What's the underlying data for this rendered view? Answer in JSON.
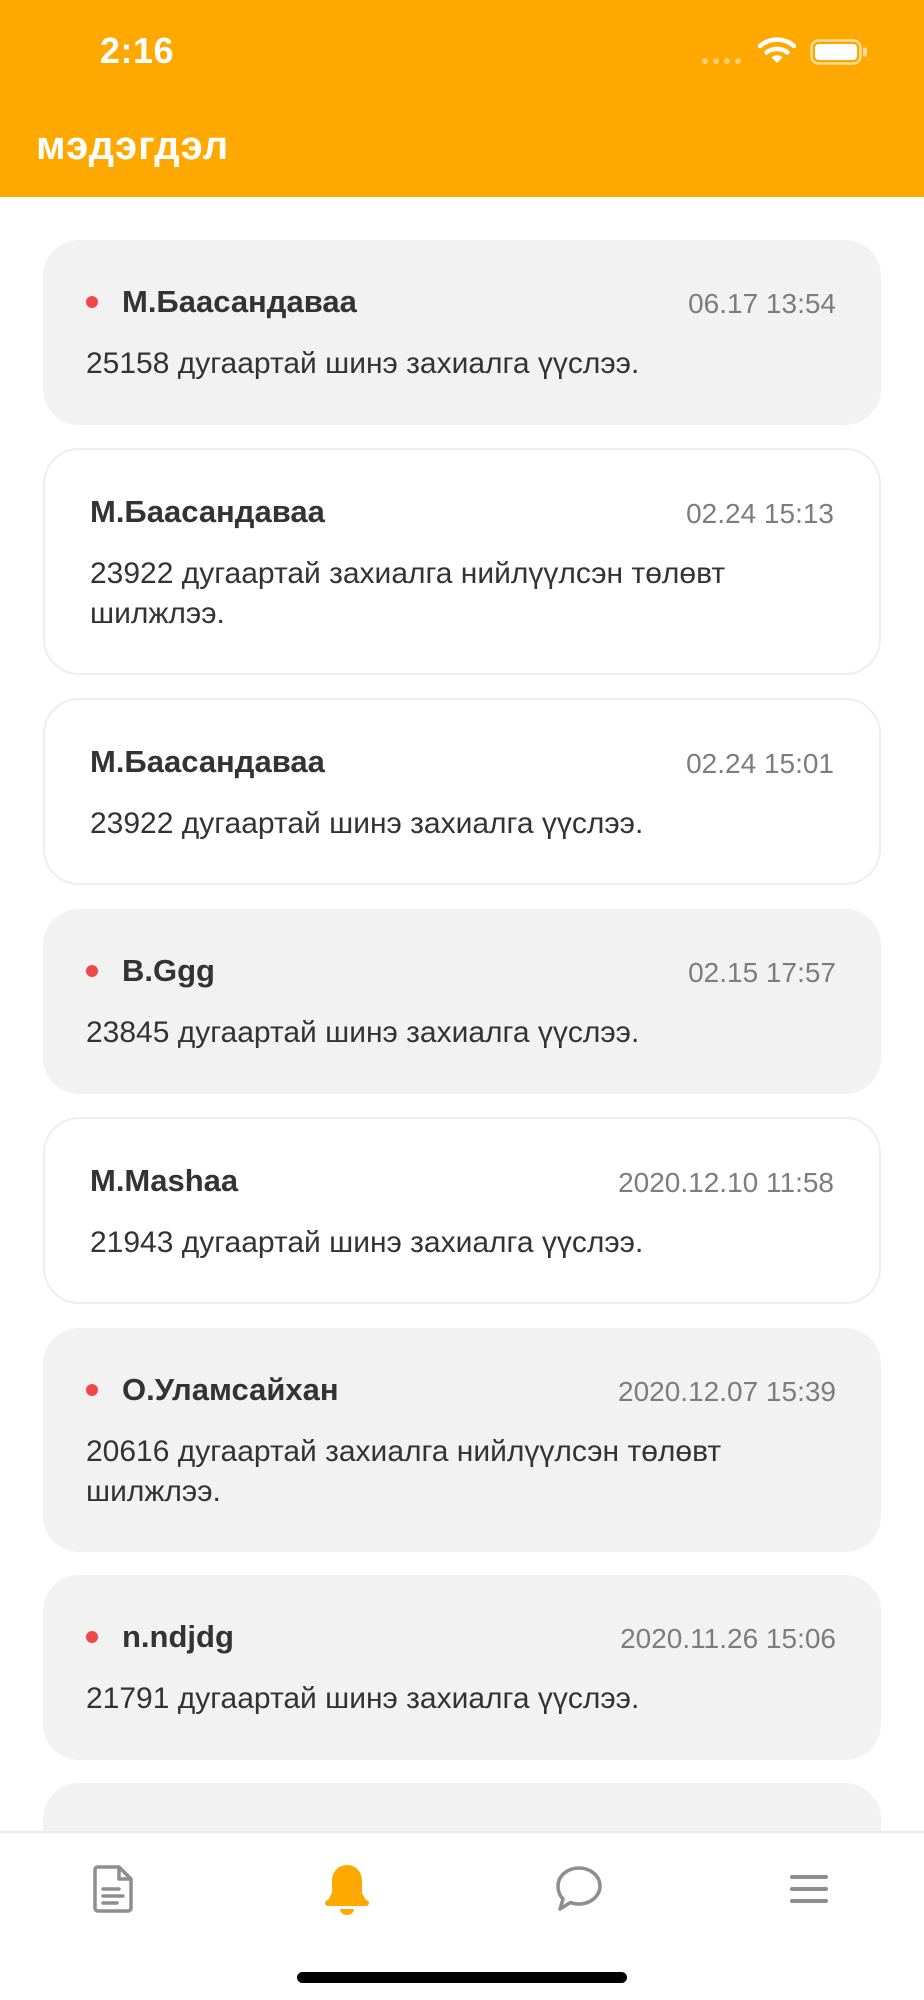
{
  "status_bar": {
    "time": "2:16"
  },
  "header": {
    "title": "мэдэгдэл",
    "background": "#FFA800"
  },
  "notifications": [
    {
      "sender": "М.Баасандаваа",
      "time": "06.17 13:54",
      "message": "25158 дугаартай шинэ захиалга үүслээ.",
      "unread": true
    },
    {
      "sender": "М.Баасандаваа",
      "time": "02.24 15:13",
      "message": "23922 дугаартай захиалга нийлүүлсэн төлөвт шилжлээ.",
      "unread": false
    },
    {
      "sender": "М.Баасандаваа",
      "time": "02.24 15:01",
      "message": "23922 дугаартай шинэ захиалга үүслээ.",
      "unread": false
    },
    {
      "sender": "B.Ggg",
      "time": "02.15 17:57",
      "message": "23845 дугаартай шинэ захиалга үүслээ.",
      "unread": true
    },
    {
      "sender": "M.Mashaa",
      "time": "2020.12.10 11:58",
      "message": "21943 дугаартай шинэ захиалга үүслээ.",
      "unread": false
    },
    {
      "sender": "О.Уламсайхан",
      "time": "2020.12.07 15:39",
      "message": "20616 дугаартай захиалга нийлүүлсэн төлөвт шилжлээ.",
      "unread": true
    },
    {
      "sender": "n.ndjdg",
      "time": "2020.11.26 15:06",
      "message": "21791 дугаартай шинэ захиалга үүслээ.",
      "unread": true
    }
  ],
  "tabbar": {
    "items": [
      {
        "icon": "document-icon",
        "active": false
      },
      {
        "icon": "bell-icon",
        "active": true
      },
      {
        "icon": "chat-icon",
        "active": false
      },
      {
        "icon": "menu-icon",
        "active": false
      }
    ],
    "active_color": "#FFA800",
    "inactive_color": "#8E8E8E"
  },
  "colors": {
    "unread_dot": "#F04848",
    "unread_card": "#F2F2F2",
    "read_card_border": "#EEEEEE"
  }
}
